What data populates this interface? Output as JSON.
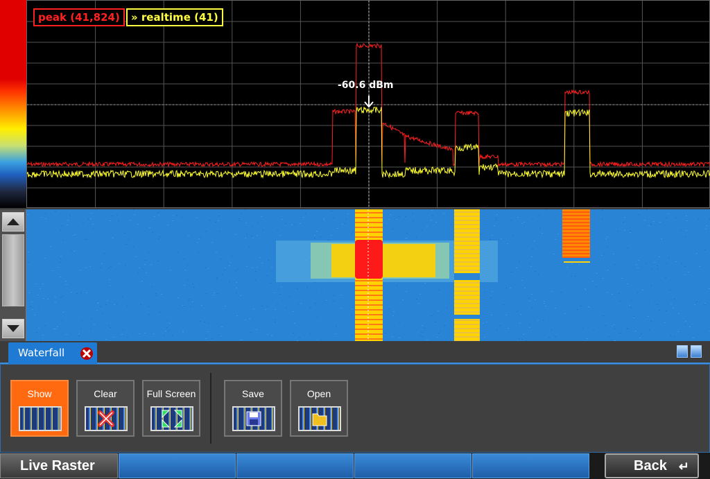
{
  "spectrum": {
    "legend_peak": "peak (41,824)",
    "legend_realtime": "» realtime (41)",
    "marker_label": "-60.6 dBm",
    "colors": {
      "peak": "#ff2020",
      "realtime": "#ffff30",
      "grid": "#555555"
    }
  },
  "waterfall": {
    "colors": {
      "background": "#2a84d6",
      "signal_hot": "#ff1a1a",
      "signal_warm": "#ffd200"
    }
  },
  "tabs": [
    {
      "label": "Waterfall",
      "active": true
    }
  ],
  "toolbar": {
    "buttons": [
      {
        "label": "Show",
        "active": true
      },
      {
        "label": "Clear"
      },
      {
        "label": "Full Screen"
      },
      {
        "label": "Save"
      },
      {
        "label": "Open"
      }
    ]
  },
  "bottombar": {
    "title": "Live Raster",
    "back_label": "Back",
    "back_icon": "↵"
  }
}
